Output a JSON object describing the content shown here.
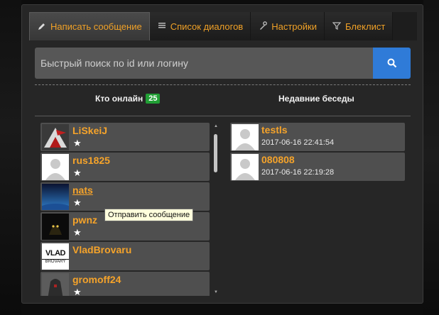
{
  "tabs": [
    {
      "label": "Написать сообщение",
      "icon": "pencil-icon"
    },
    {
      "label": "Список диалогов",
      "icon": "list-icon"
    },
    {
      "label": "Настройки",
      "icon": "wrench-icon"
    },
    {
      "label": "Блеклист",
      "icon": "filter-icon"
    }
  ],
  "search": {
    "placeholder": "Быстрый поиск по id или логину",
    "button_icon": "search-icon"
  },
  "online": {
    "title": "Кто онлайн",
    "count": "25"
  },
  "recent": {
    "title": "Недавние беседы"
  },
  "users": [
    {
      "name": "LiSkeiJ",
      "star": "★"
    },
    {
      "name": "rus1825",
      "star": "★"
    },
    {
      "name": "nats",
      "star": "★"
    },
    {
      "name": "pwnz",
      "star": "★"
    },
    {
      "name": "VladBrovaru",
      "star": ""
    },
    {
      "name": "gromoff24",
      "star": "★"
    }
  ],
  "avatar_text": {
    "vlad_top": "VLAD",
    "vlad_bottom": "BROVARY"
  },
  "conversations": [
    {
      "name": "testls",
      "time": "2017-06-16 22:41:54"
    },
    {
      "name": "080808",
      "time": "2017-06-16 22:19:28"
    }
  ],
  "tooltip": {
    "text": "Отправить сообщение"
  },
  "colors": {
    "accent": "#f5a32a",
    "badge": "#21a035",
    "search_button": "#2f7bd8"
  }
}
